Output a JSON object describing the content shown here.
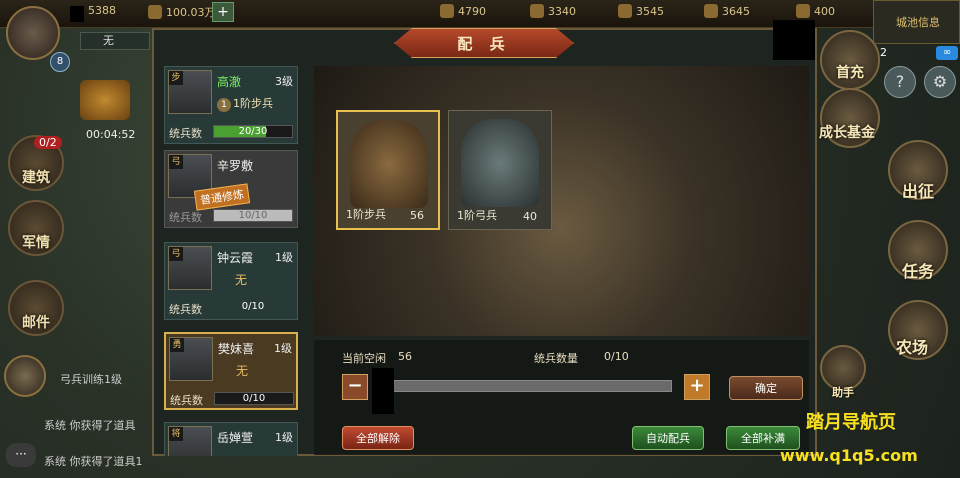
{
  "topbar": {
    "res1": "5388",
    "res2": "100.03万",
    "res3": "4790",
    "res4": "3340",
    "res5": "3545",
    "res6": "3645",
    "res7": "400",
    "player_name": "无",
    "player_level": "8",
    "timer": "00:04:52",
    "info_badge": "2",
    "info_label": "城池信息"
  },
  "left_menu": {
    "build_badge": "0/2",
    "build": "建筑",
    "military": "军情",
    "mail": "邮件"
  },
  "chat": {
    "line1": "弓兵训练1级",
    "line2": "系统 你获得了道具",
    "line3": "系统 你获得了道具1"
  },
  "panel": {
    "title": "配 兵"
  },
  "generals": [
    {
      "type": "步",
      "name": "高澈",
      "level": "3级",
      "troop": "1阶步兵",
      "troop_tier": "1",
      "label": "统兵数",
      "value": "20/30",
      "fill": 0.667
    },
    {
      "type": "弓",
      "name": "辛罗敷",
      "stamp": "普通修炼",
      "label": "统兵数",
      "value": "10/10",
      "fill": 1.0
    },
    {
      "type": "弓",
      "name": "钟云霞",
      "level": "1级",
      "troop": "无",
      "label": "统兵数",
      "value": "0/10",
      "fill": 0
    },
    {
      "type": "勇",
      "name": "樊妹喜",
      "level": "1级",
      "troop": "无",
      "label": "统兵数",
      "value": "0/10",
      "fill": 0
    },
    {
      "type": "将",
      "name": "岳婵萱",
      "level": "1级"
    }
  ],
  "units": [
    {
      "name": "1阶步兵",
      "count": "56"
    },
    {
      "name": "1阶弓兵",
      "count": "40"
    }
  ],
  "controls": {
    "idle_label": "当前空闲",
    "idle_value": "56",
    "count_label": "统兵数量",
    "count_value": "0/10",
    "minus": "−",
    "plus": "+",
    "confirm": "确定",
    "release_all": "全部解除",
    "auto_assign": "自动配兵",
    "fill_all": "全部补满"
  },
  "right_menu": {
    "first_charge": "首充",
    "fund": "成长基金",
    "expedition": "出征",
    "quest": "任务",
    "farm": "农场",
    "helper": "助手"
  },
  "watermark": {
    "line1": "踏月导航页",
    "line2": "www.q1q5.com"
  }
}
